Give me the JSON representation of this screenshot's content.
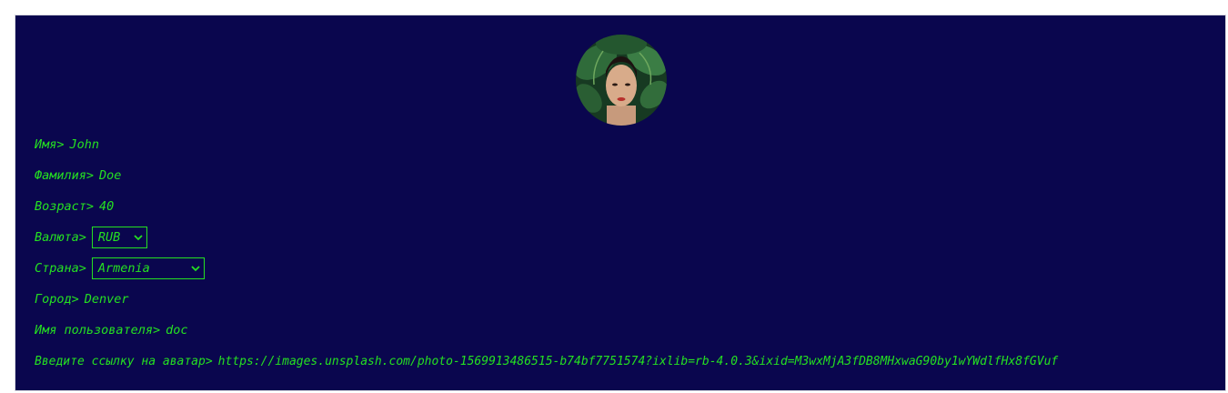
{
  "colors": {
    "background": "#0a064e",
    "text": "#25e021"
  },
  "profile": {
    "avatar": "avatar-photo",
    "fields": {
      "name": {
        "label": "Имя>",
        "value": "John"
      },
      "surname": {
        "label": "Фамилия>",
        "value": "Doe"
      },
      "age": {
        "label": "Возраст>",
        "value": "40"
      },
      "currency": {
        "label": "Валюта>",
        "selected": "RUB"
      },
      "country": {
        "label": "Страна>",
        "selected": "Armenia"
      },
      "city": {
        "label": "Город>",
        "value": "Denver"
      },
      "username": {
        "label": "Имя пользователя>",
        "value": "doc"
      },
      "avatar_url": {
        "label": "Введите ссылку на аватар>",
        "value": "https://images.unsplash.com/photo-1569913486515-b74bf7751574?ixlib=rb-4.0.3&ixid=M3wxMjA3fDB8MHxwaG90by1wYWdlfHx8fGVuf"
      }
    }
  },
  "icons": {
    "dropdown": "chevron-down-icon"
  }
}
